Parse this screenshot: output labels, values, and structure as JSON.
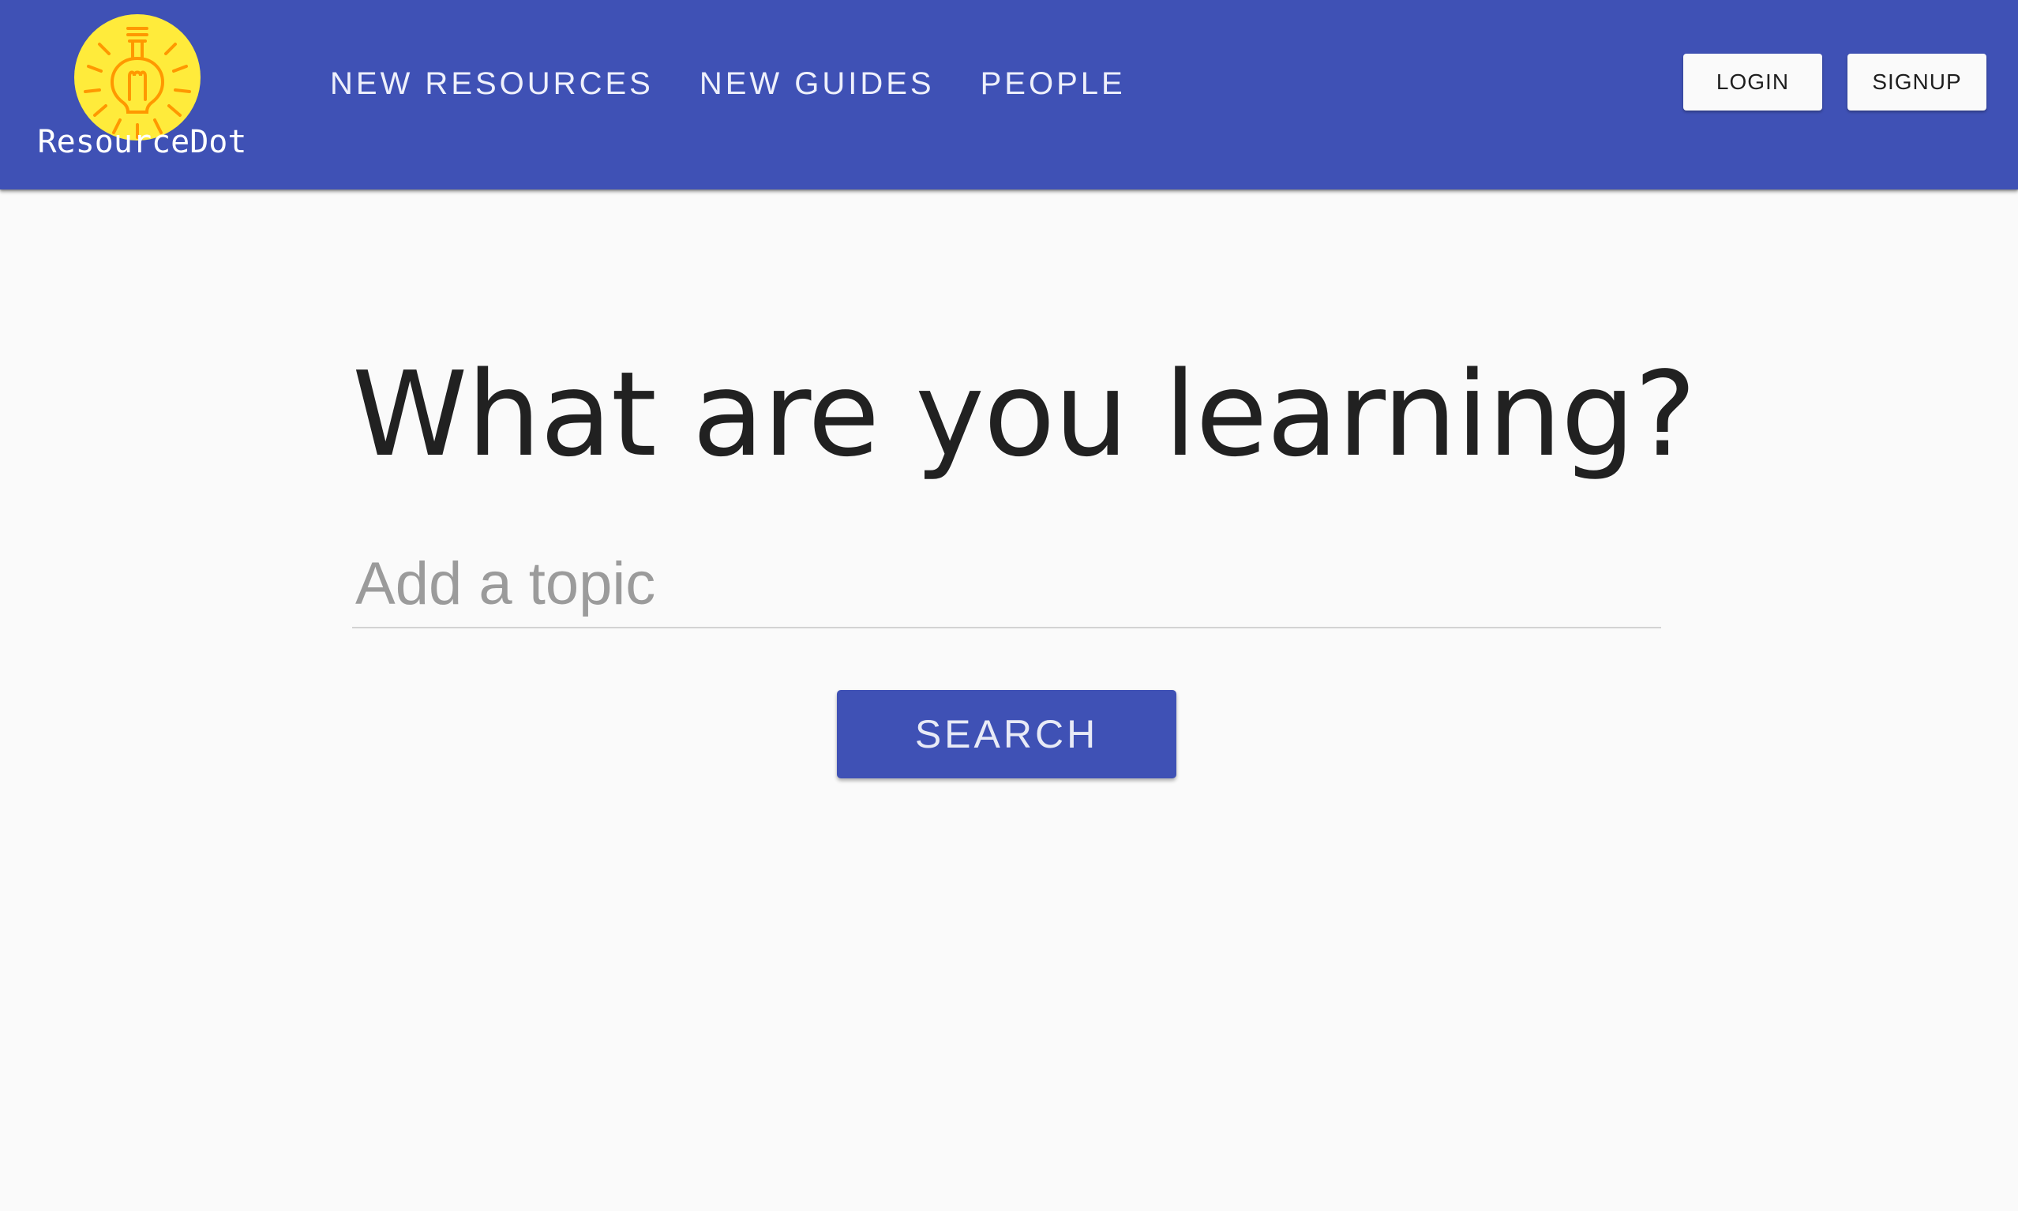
{
  "app": {
    "brand_name": "ResourceDot",
    "colors": {
      "primary": "#3f51b5",
      "logo_circle": "#ffeb3b",
      "logo_bulb": "#ff9800",
      "background": "#fafafa",
      "headline_text": "#212121",
      "placeholder_text": "#9b9b9b"
    }
  },
  "header": {
    "logo_icon": "lightbulb-icon",
    "nav": [
      {
        "label": "NEW RESOURCES"
      },
      {
        "label": "NEW GUIDES"
      },
      {
        "label": "PEOPLE"
      }
    ],
    "login_label": "LOGIN",
    "signup_label": "SIGNUP"
  },
  "main": {
    "headline": "What are you learning?",
    "topic_placeholder": "Add a topic",
    "topic_value": "",
    "search_label": "SEARCH"
  }
}
